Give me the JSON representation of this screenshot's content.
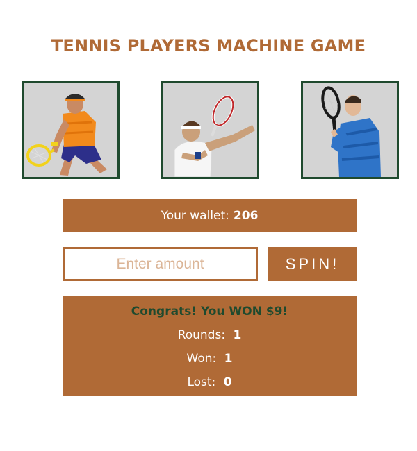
{
  "game": {
    "title": "TENNIS PLAYERS MACHINE GAME"
  },
  "reels": [
    {
      "name": "player-orange-shirt",
      "icon": "tennis-player-image"
    },
    {
      "name": "player-white-shirt",
      "icon": "tennis-player-image"
    },
    {
      "name": "player-blue-shirt",
      "icon": "tennis-player-image"
    }
  ],
  "wallet": {
    "label": "Your wallet:",
    "value": "206"
  },
  "bet": {
    "placeholder": "Enter amount",
    "value": ""
  },
  "spin": {
    "label": "SPIN!"
  },
  "result": {
    "message": "Congrats! You WON $9!",
    "rounds_label": "Rounds:",
    "rounds_value": "1",
    "won_label": "Won:",
    "won_value": "1",
    "lost_label": "Lost:",
    "lost_value": "0"
  },
  "colors": {
    "accent": "#b06a36",
    "frame": "#1f4a2e",
    "reel_bg": "#d4d4d4",
    "message": "#1f4a2e"
  }
}
